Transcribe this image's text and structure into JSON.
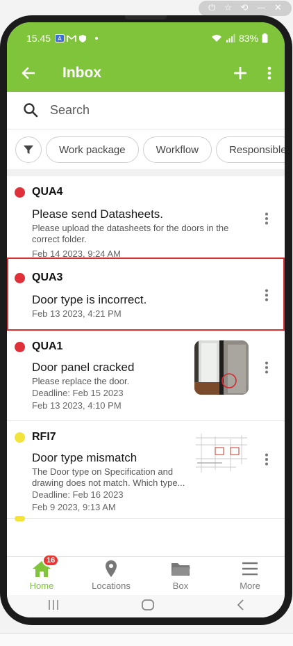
{
  "emulator": {
    "controls": [
      "⏻",
      "☆",
      "⟲",
      "—",
      "✕"
    ]
  },
  "status_bar": {
    "time": "15.45",
    "battery": "83%"
  },
  "app_bar": {
    "title": "Inbox"
  },
  "search": {
    "placeholder": "Search"
  },
  "filters": {
    "chips": [
      "Work package",
      "Workflow",
      "Responsible"
    ]
  },
  "items": [
    {
      "code": "QUA4",
      "priority_color": "#e0313b",
      "title": "Please send Datasheets.",
      "description": "Please upload the datasheets for the doors in the correct folder.",
      "deadline": "",
      "date": "Feb 14 2023, 9:24 AM"
    },
    {
      "code": "QUA3",
      "priority_color": "#e0313b",
      "title": "Door type is incorrect.",
      "description": "",
      "deadline": "",
      "date": "Feb 13 2023, 4:21 PM"
    },
    {
      "code": "QUA1",
      "priority_color": "#e0313b",
      "title": "Door panel cracked",
      "description": "Please replace the door.",
      "deadline": "Deadline: Feb 15 2023",
      "date": "Feb 13 2023, 4:10 PM"
    },
    {
      "code": "RFI7",
      "priority_color": "#f2e43a",
      "title": "Door type mismatch",
      "description": "The Door type on Specification and drawing does not match. Which type...",
      "deadline": "Deadline: Feb 16 2023",
      "date": "Feb 9 2023, 9:13 AM"
    }
  ],
  "bottom_nav": {
    "badge": "16",
    "items": [
      {
        "label": "Home",
        "icon": "home-icon"
      },
      {
        "label": "Locations",
        "icon": "location-pin-icon"
      },
      {
        "label": "Box",
        "icon": "folder-icon"
      },
      {
        "label": "More",
        "icon": "menu-icon"
      }
    ]
  },
  "colors": {
    "accent": "#80c43b",
    "high_priority": "#e0313b",
    "medium_priority": "#f2e43a",
    "selected_outline": "#d32f2f"
  }
}
